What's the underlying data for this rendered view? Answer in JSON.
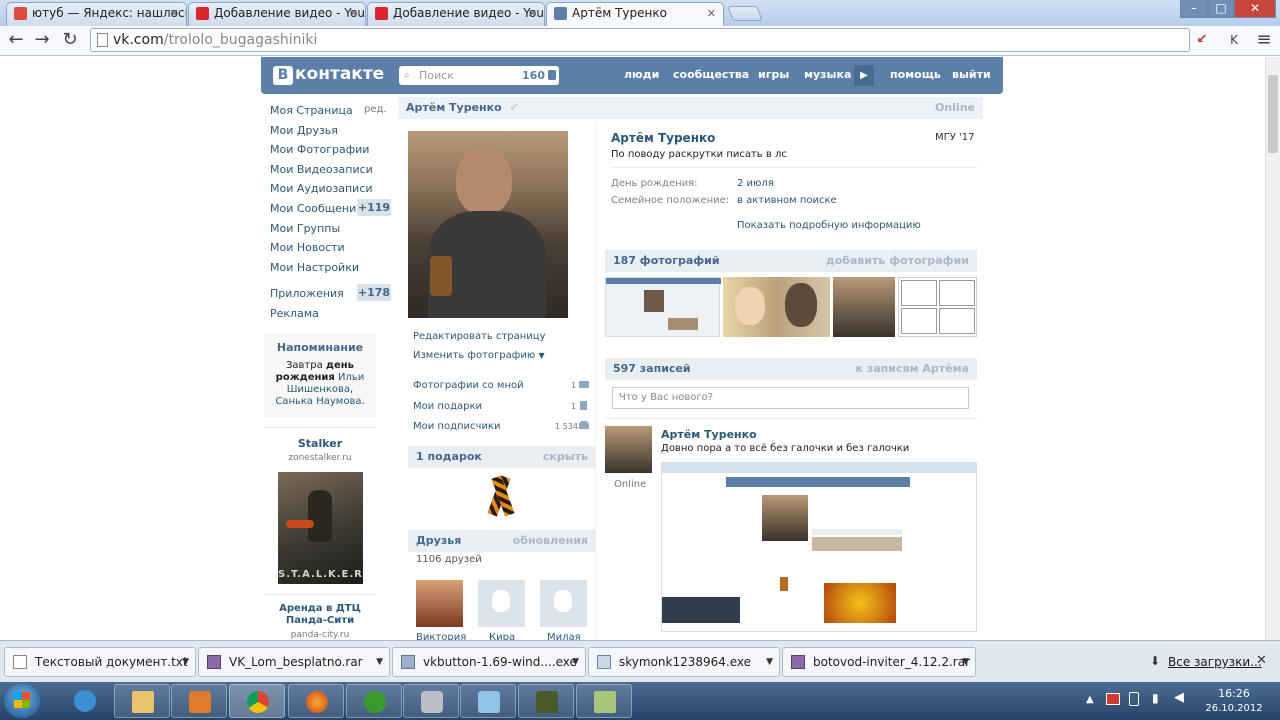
{
  "browser": {
    "tabs": [
      {
        "title": "ютуб — Яндекс: нашлось",
        "icon": "yandex-icon",
        "color": "#e04a3f"
      },
      {
        "title": "Добавление видео - YouT",
        "icon": "youtube-icon",
        "color": "#d9282d"
      },
      {
        "title": "Добавление видео - YouT",
        "icon": "youtube-icon",
        "color": "#d9282d"
      },
      {
        "title": "Артём Туренко",
        "icon": "vk-icon",
        "color": "#5b7fa6"
      }
    ],
    "url_host": "vk.com",
    "url_path": "/trololo_bugagashiniki"
  },
  "vk": {
    "logo_text": "контакте",
    "logo_letter": "В",
    "search_placeholder": "Поиск",
    "search_count": "160",
    "nav": [
      "люди",
      "сообщества",
      "игры",
      "музыка",
      "помощь",
      "выйти"
    ],
    "left_menu": [
      "Моя Страница",
      "Мои Друзья",
      "Мои Фотографии",
      "Мои Видеозаписи",
      "Мои Аудиозаписи",
      "Мои Сообщения",
      "Мои Группы",
      "Мои Новости",
      "Мои Настройки"
    ],
    "edit_link": "ред.",
    "messages_badge": "+119",
    "apps_label": "Приложения",
    "apps_badge": "+178",
    "ads_label": "Реклама",
    "reminder": {
      "title": "Напоминание",
      "t1": "Завтра ",
      "t2": "день рождения",
      "t3": " Ильи Шишенкова",
      "t4": ", ",
      "t5": "Санька Наумова",
      "t6": "."
    },
    "ad1": {
      "title": "Stalker",
      "site": "zonestalker.ru",
      "image_text": "S.T.A.L.K.E.R."
    },
    "ad2": {
      "title": "Аренда в ДТЦ Панда-Сити",
      "site": "panda-city.ru"
    },
    "profile": {
      "name_header": "Артём Туренко",
      "online": "Online",
      "name": "Артём Туренко",
      "education": "МГУ '17",
      "status": "По поводу раскрутки писать в лс",
      "birthday_label": "День рождения:",
      "birthday_value": "2 июля",
      "family_label": "Семейное положение:",
      "family_value": "в активном поиске",
      "more_info": "Показать подробную информацию",
      "edit_page": "Редактировать страницу",
      "change_photo": "Изменить фотографию",
      "photos_with_me": "Фотографии со мной",
      "photos_with_me_count": "1",
      "my_gifts": "Мои подарки",
      "my_gifts_count": "1",
      "my_followers": "Мои подписчики",
      "my_followers_count": "1 534",
      "gifts_header": "1 подарок",
      "gifts_hide": "скрыть",
      "friends_header": "Друзья",
      "friends_updates": "обновления",
      "friends_count": "1106 друзей",
      "friends": [
        "Виктория",
        "Кира",
        "Милая"
      ],
      "photos_header": "187 фотографий",
      "photos_add": "добавить фотографии",
      "posts_header": "597 записей",
      "posts_link": "к записям Артёма",
      "whats_new_placeholder": "Что у Вас нового?",
      "post_author": "Артём Туренко",
      "post_text": "Довно пора а то всё без галочки и без галочки",
      "post_online": "Online"
    }
  },
  "downloads": {
    "items": [
      {
        "name": "Текстовый документ.txt",
        "icon": "text-file-icon"
      },
      {
        "name": "VK_Lom_besplatno.rar",
        "icon": "rar-archive-icon"
      },
      {
        "name": "vkbutton-1.69-wind....exe",
        "icon": "exe-file-icon"
      },
      {
        "name": "skymonk1238964.exe",
        "icon": "exe-file-icon"
      },
      {
        "name": "botovod-inviter_4.12.2.rar",
        "icon": "rar-archive-icon"
      }
    ],
    "all_downloads": "Все загрузки..."
  },
  "taskbar": {
    "time": "16:26",
    "date": "26.10.2012"
  }
}
